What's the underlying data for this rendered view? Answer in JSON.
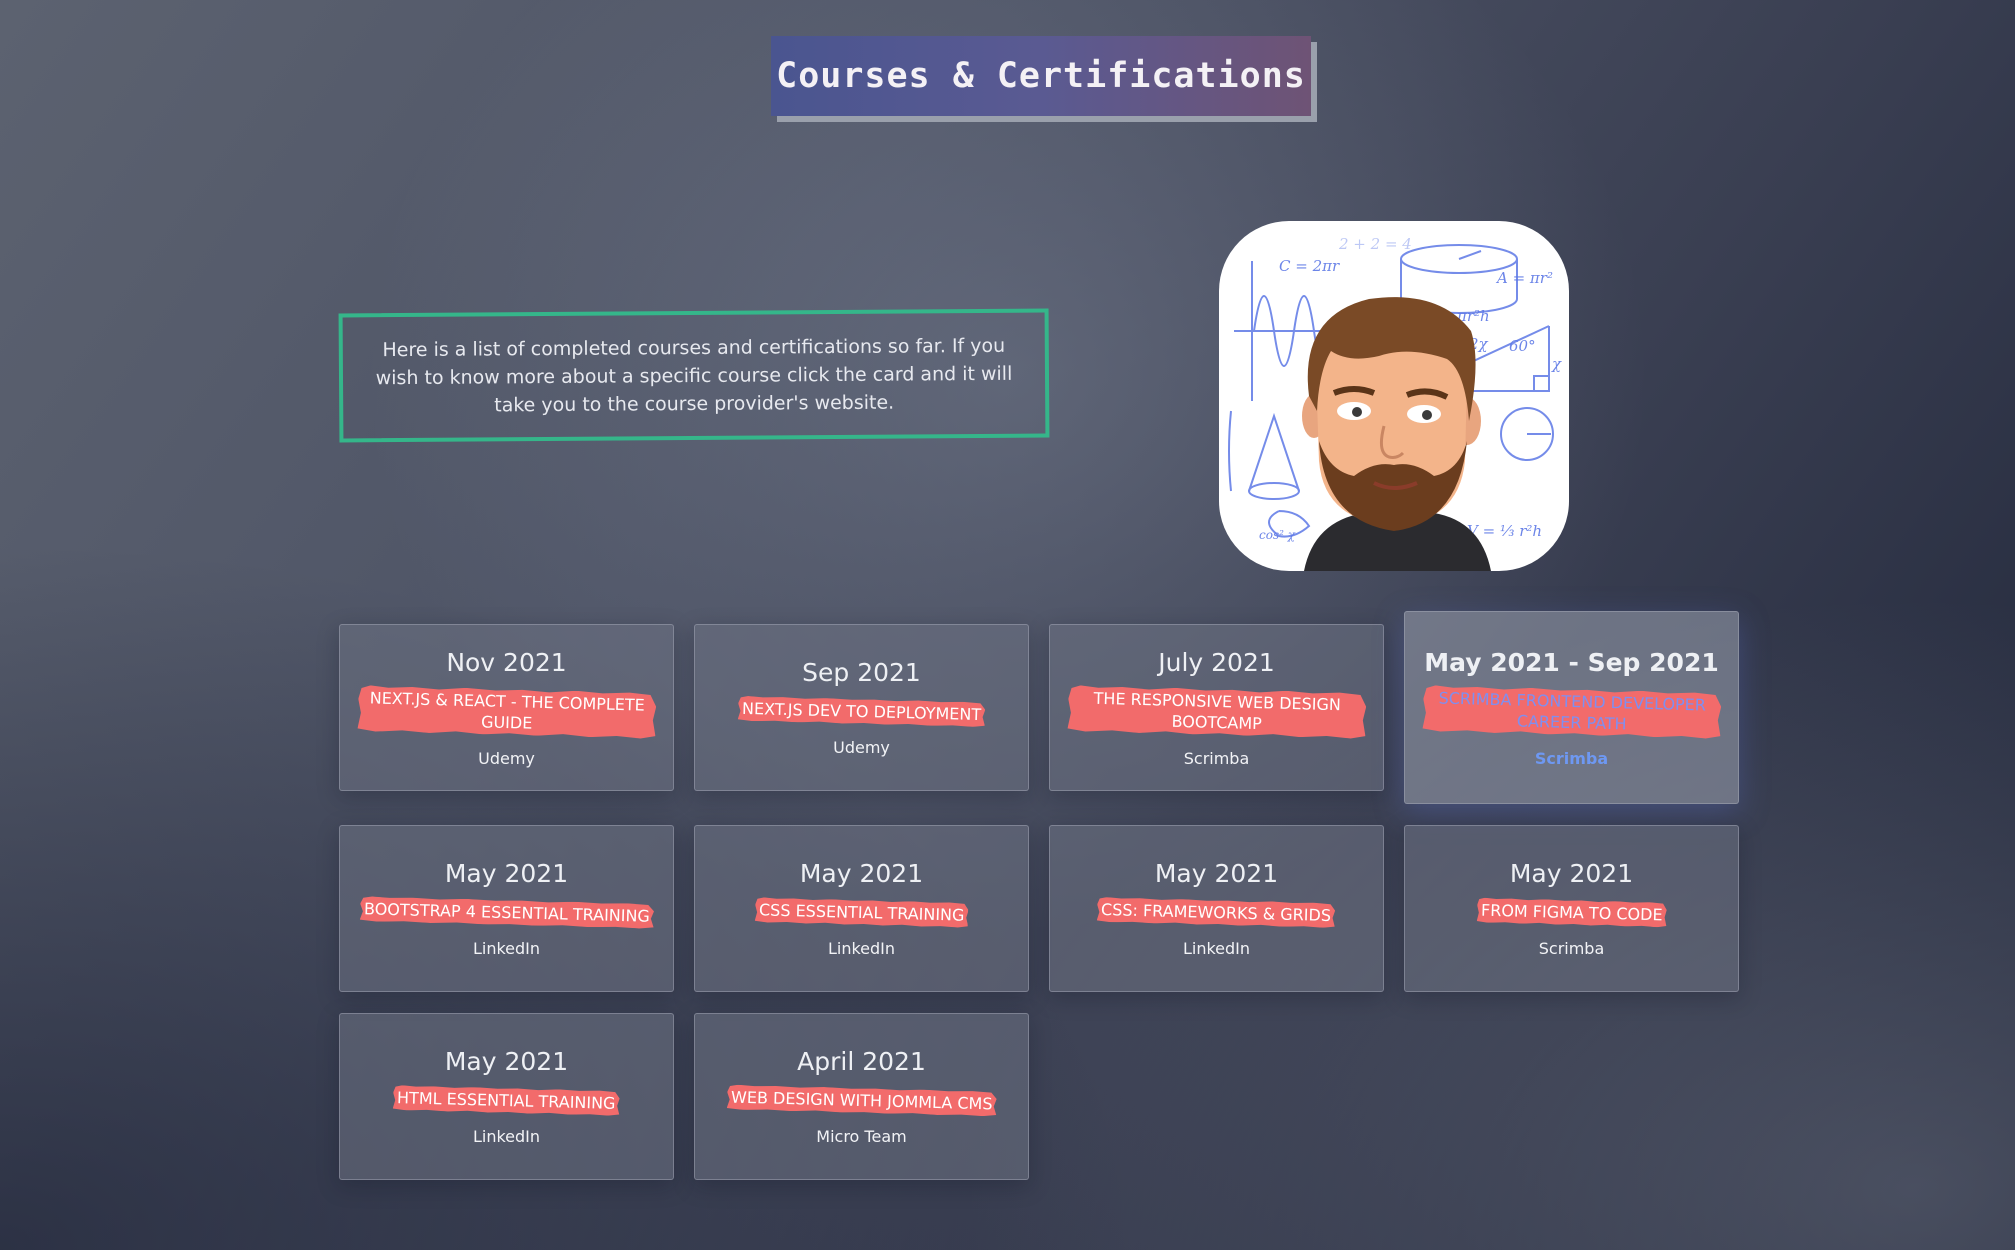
{
  "header": {
    "title": "Courses & Certifications"
  },
  "intro": {
    "text": "Here is a list of completed courses and certifications so far. If you wish to know more about a specific course click the card and it will take you to the course provider's website."
  },
  "avatar": {
    "formulas": [
      "C = 2πr",
      "A = πr²",
      "πr²h",
      "2χ",
      "60°",
      "χ",
      "V = ⅓ r²h",
      "2 + 2 = 4",
      "cos² χ"
    ]
  },
  "colors": {
    "accent_green": "#35b68a",
    "tag_red": "#f26b6b",
    "link_blue": "#6e98f2"
  },
  "cards": [
    {
      "date": "Nov 2021",
      "title": "Next.js & React - The Complete Guide",
      "provider": "Udemy"
    },
    {
      "date": "Sep 2021",
      "title": "Next.js Dev to Deployment",
      "provider": "Udemy"
    },
    {
      "date": "July 2021",
      "title": "The Responsive Web Design Bootcamp",
      "provider": "Scrimba"
    },
    {
      "date": "May 2021 - Sep 2021",
      "title": "Scrimba Frontend Developer Career Path",
      "provider": "Scrimba"
    },
    {
      "date": "May 2021",
      "title": "Bootstrap 4 Essential Training",
      "provider": "LinkedIn"
    },
    {
      "date": "May 2021",
      "title": "CSS Essential Training",
      "provider": "LinkedIn"
    },
    {
      "date": "May 2021",
      "title": "CSS: Frameworks & Grids",
      "provider": "LinkedIn"
    },
    {
      "date": "May 2021",
      "title": "From Figma to Code",
      "provider": "Scrimba"
    },
    {
      "date": "May 2021",
      "title": "HTML Essential Training",
      "provider": "LinkedIn"
    },
    {
      "date": "April 2021",
      "title": "Web Design with Jommla CMS",
      "provider": "Micro Team"
    }
  ]
}
